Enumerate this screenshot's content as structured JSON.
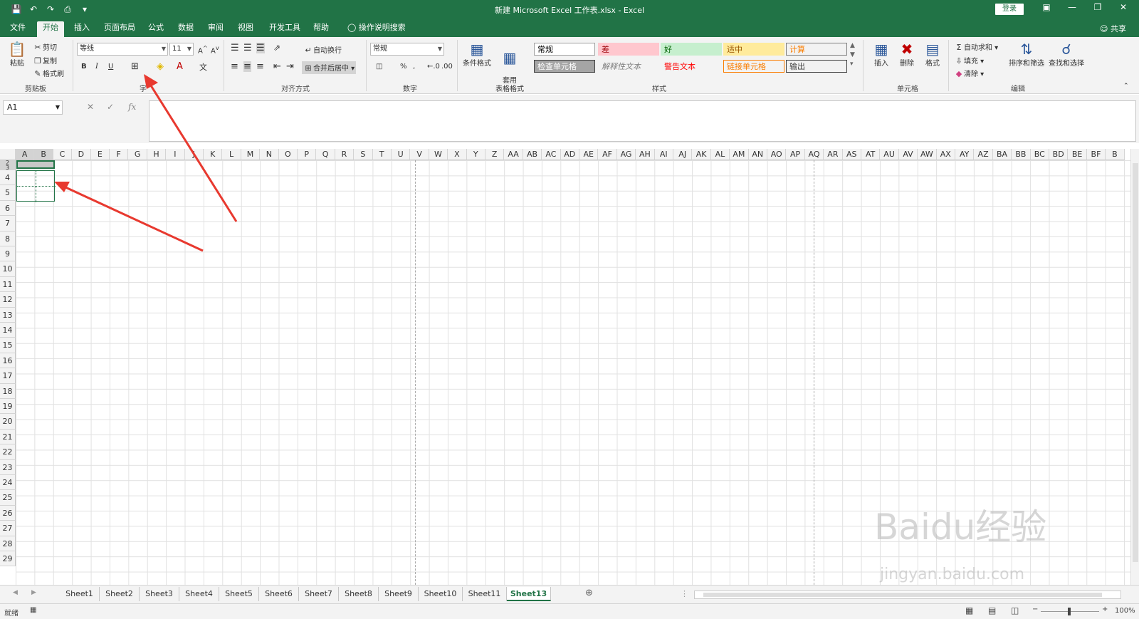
{
  "window": {
    "title": "新建 Microsoft Excel 工作表.xlsx  -  Excel",
    "login_label": "登录",
    "share_label": "共享"
  },
  "tabs": [
    "文件",
    "开始",
    "插入",
    "页面布局",
    "公式",
    "数据",
    "审阅",
    "视图",
    "开发工具",
    "帮助"
  ],
  "active_tab": "开始",
  "tell_me": "操作说明搜索",
  "ribbon": {
    "clipboard": {
      "paste": "粘贴",
      "cut": "剪切",
      "copy": "复制",
      "format_painter": "格式刷",
      "label": "剪贴板"
    },
    "font": {
      "name": "等线",
      "size": "11",
      "bold": "B",
      "italic": "I",
      "underline": "U",
      "label": "字"
    },
    "alignment": {
      "wrap": "自动换行",
      "merge": "合并后居中",
      "label": "对齐方式"
    },
    "number": {
      "format": "常规",
      "percent": "%",
      "comma": ",",
      "label": "数字"
    },
    "styles": {
      "conditional": "条件格式",
      "table": "套用\n表格格式",
      "cells": [
        {
          "text": "常规",
          "bg": "#ffffff",
          "color": "#000000",
          "border": "#a0a0a0"
        },
        {
          "text": "差",
          "bg": "#ffc7ce",
          "color": "#9c0006",
          "border": "#ffc7ce"
        },
        {
          "text": "好",
          "bg": "#c6efce",
          "color": "#006100",
          "border": "#c6efce"
        },
        {
          "text": "适中",
          "bg": "#ffeb9c",
          "color": "#9c5700",
          "border": "#ffeb9c"
        },
        {
          "text": "计算",
          "bg": "#f2f2f2",
          "color": "#fa7d00",
          "border": "#7f7f7f"
        },
        {
          "text": "检查单元格",
          "bg": "#a5a5a5",
          "color": "#ffffff",
          "border": "#3f3f3f"
        },
        {
          "text": "解释性文本",
          "bg": "#f3f3f3",
          "color": "#7f7f7f",
          "border": "#f3f3f3"
        },
        {
          "text": "警告文本",
          "bg": "#f3f3f3",
          "color": "#ff0000",
          "border": "#f3f3f3"
        },
        {
          "text": "链接单元格",
          "bg": "#f3f3f3",
          "color": "#fa7d00",
          "border": "#fa7d00"
        },
        {
          "text": "输出",
          "bg": "#f2f2f2",
          "color": "#3f3f3f",
          "border": "#3f3f3f"
        }
      ],
      "label": "样式"
    },
    "cells": {
      "insert": "插入",
      "delete": "删除",
      "format": "格式",
      "label": "单元格"
    },
    "editing": {
      "autosum": "自动求和",
      "fill": "填充",
      "clear": "清除",
      "sort": "排序和筛选",
      "find": "查找和选择",
      "label": "编辑"
    }
  },
  "namebox": "A1",
  "fx_label": "fx",
  "columns": [
    "A",
    "B",
    "C",
    "D",
    "E",
    "F",
    "G",
    "H",
    "I",
    "J",
    "K",
    "L",
    "M",
    "N",
    "O",
    "P",
    "Q",
    "R",
    "S",
    "T",
    "U",
    "V",
    "W",
    "X",
    "Y",
    "Z",
    "AA",
    "AB",
    "AC",
    "AD",
    "AE",
    "AF",
    "AG",
    "AH",
    "AI",
    "AJ",
    "AK",
    "AL",
    "AM",
    "AN",
    "AO",
    "AP",
    "AQ",
    "AR",
    "AS",
    "AT",
    "AU",
    "AV",
    "AW",
    "AX",
    "AY",
    "AZ",
    "BA",
    "BB",
    "BC",
    "BD",
    "BE",
    "BF",
    "B"
  ],
  "rows": [
    "2",
    "3",
    "4",
    "5",
    "6",
    "7",
    "8",
    "9",
    "10",
    "11",
    "12",
    "13",
    "14",
    "15",
    "16",
    "17",
    "18",
    "19",
    "20",
    "21",
    "22",
    "23",
    "24",
    "25",
    "26",
    "27",
    "28",
    "29"
  ],
  "sheets": [
    "Sheet1",
    "Sheet2",
    "Sheet3",
    "Sheet4",
    "Sheet5",
    "Sheet6",
    "Sheet7",
    "Sheet8",
    "Sheet9",
    "Sheet10",
    "Sheet11",
    "Sheet13"
  ],
  "active_sheet": "Sheet13",
  "status": {
    "ready": "就绪",
    "zoom": "100%"
  },
  "watermark": {
    "main": "Baidu经验",
    "sub": "jingyan.baidu.com"
  },
  "colors": {
    "brand": "#217346",
    "arrow": "#e8392f"
  }
}
